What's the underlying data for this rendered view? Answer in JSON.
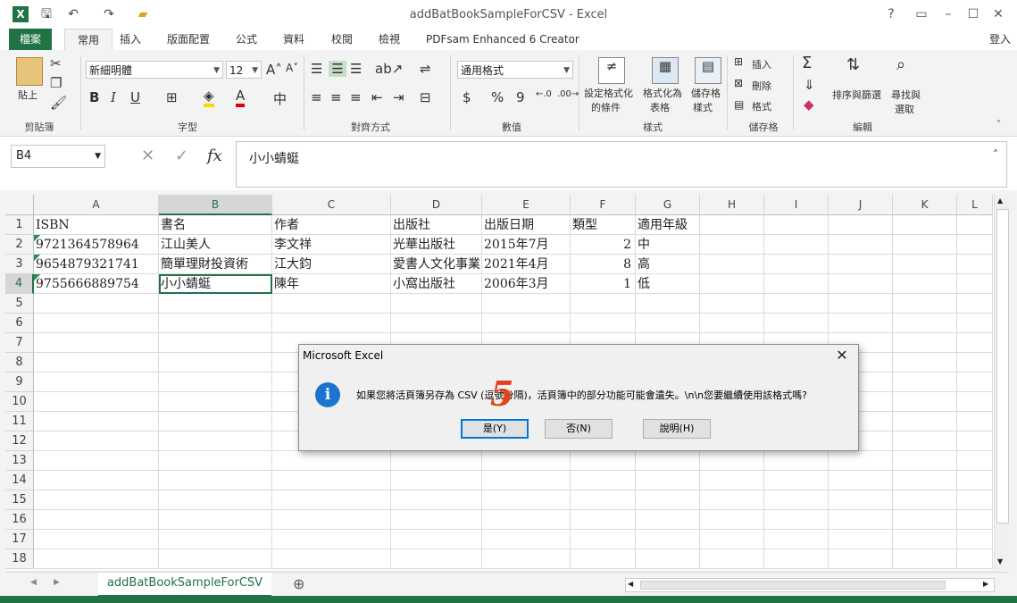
{
  "window": {
    "title": "addBatBookSampleForCSV - Excel",
    "controls": [
      "?",
      "▭",
      "–",
      "☐",
      "✕"
    ]
  },
  "quick_access": [
    "save",
    "undo",
    "redo",
    "open-folder"
  ],
  "ribbon_tabs": {
    "file": "檔案",
    "home": "常用",
    "insert": "插入",
    "layout": "版面配置",
    "formulas": "公式",
    "data": "資料",
    "review": "校閱",
    "view": "檢視",
    "pdfsam": "PDFsam Enhanced 6 Creator",
    "signin": "登入"
  },
  "ribbon": {
    "clipboard": {
      "paste": "貼上",
      "label": "剪貼簿"
    },
    "font": {
      "name": "新細明體",
      "size": "12",
      "bold": "B",
      "italic": "I",
      "underline": "U",
      "label": "字型"
    },
    "alignment": {
      "label": "對齊方式"
    },
    "number": {
      "format": "通用格式",
      "currency": "$",
      "percent": "%",
      "comma": "9",
      "label": "數值"
    },
    "styles": {
      "cond1": "設定格式化",
      "cond2": "的條件",
      "table1": "格式化為",
      "table2": "表格",
      "cell1": "儲存格",
      "cell2": "樣式",
      "label": "樣式"
    },
    "cells": {
      "insert": "插入",
      "delete": "刪除",
      "format": "格式",
      "label": "儲存格"
    },
    "editing": {
      "sum": "Σ",
      "sort1": "排序與篩選",
      "find1": "尋找與",
      "find2": "選取",
      "label": "編輯"
    }
  },
  "formula_bar": {
    "name_box": "B4",
    "cancel": "✕",
    "enter": "✓",
    "fx": "fx",
    "content": "小小蜻蜓"
  },
  "columns": [
    "A",
    "B",
    "C",
    "D",
    "E",
    "F",
    "G",
    "H",
    "I",
    "J",
    "K",
    "L"
  ],
  "rows": [
    "1",
    "2",
    "3",
    "4",
    "5",
    "6",
    "7",
    "8",
    "9",
    "10",
    "11",
    "12",
    "13",
    "14",
    "15",
    "16",
    "17",
    "18"
  ],
  "sheet": {
    "header": [
      "ISBN",
      "書名",
      "作者",
      "出版社",
      "出版日期",
      "類型",
      "適用年級"
    ],
    "data": [
      [
        "9721364578964",
        "江山美人",
        "李文祥",
        "光華出版社",
        "2015年7月",
        "2",
        "中"
      ],
      [
        "9654879321741",
        "簡單理財投資術",
        "江大鈞",
        "愛書人文化事業",
        "2021年4月",
        "8",
        "高"
      ],
      [
        "9755666889754",
        "小小蜻蜓",
        "陳年",
        "小窩出版社",
        "2006年3月",
        "1",
        "低"
      ]
    ]
  },
  "sheet_tabs": {
    "active": "addBatBookSampleForCSV",
    "add": "⊕"
  },
  "dialog": {
    "title": "Microsoft Excel",
    "icon": "i",
    "message": "如果您將活頁簿另存為 CSV (逗號分隔)，活頁簿中的部分功能可能會遺失。\\n\\n您要繼續使用該格式嗎?",
    "yes": "是(Y)",
    "no": "否(N)",
    "help": "說明(H)",
    "close": "✕"
  },
  "annotation": "5",
  "accent_color": "#217346"
}
